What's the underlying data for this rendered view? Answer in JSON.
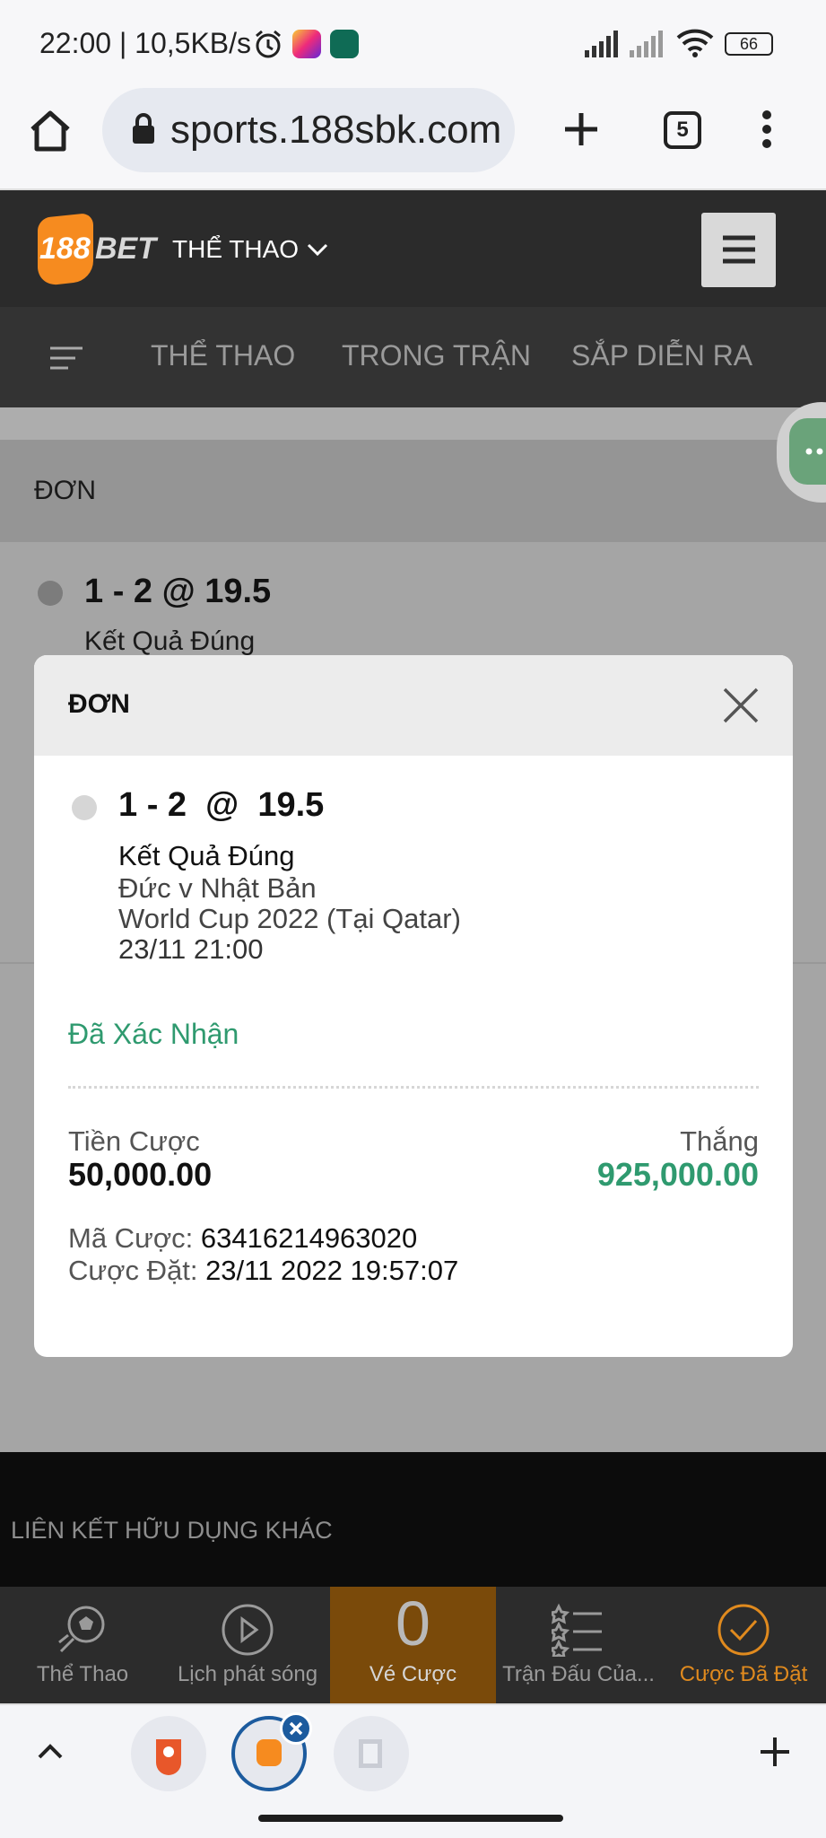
{
  "status_bar": {
    "time_speed": "22:00 | 10,5KB/s",
    "battery": "66"
  },
  "browser": {
    "url": "sports.188sbk.com",
    "tab_count": "5"
  },
  "site_header": {
    "logo_number": "188",
    "logo_word": "BET",
    "sport_dropdown": "THỂ THAO"
  },
  "nav": {
    "tabs": [
      "THỂ THAO",
      "TRONG TRẬN",
      "SẮP DIỄN RA"
    ]
  },
  "background": {
    "section_title": "ĐƠN",
    "odds": "1 - 2  @  19.5",
    "market": "Kết Quả Đúng"
  },
  "modal": {
    "title": "ĐƠN",
    "odds": "1 - 2  @  19.5",
    "market": "Kết Quả Đúng",
    "match": "Đức v Nhật Bản",
    "competition": "World Cup 2022 (Tại Qatar)",
    "kickoff": "23/11 21:00",
    "status": "Đã Xác Nhận",
    "stake_label": "Tiền Cược",
    "stake_value": "50,000.00",
    "win_label": "Thắng",
    "win_value": "925,000.00",
    "ref_label": "Mã Cược:",
    "ref_value": "63416214963020",
    "placed_label": "Cược Đặt:",
    "placed_value": "23/11 2022 19:57:07"
  },
  "footer": {
    "links_title": "LIÊN KẾT HỮU DỤNG KHÁC"
  },
  "bottom_nav": {
    "items": [
      "Thể Thao",
      "Lịch phát sóng",
      "Vé Cược",
      "Trận Đấu Của...",
      "Cược Đã Đặt"
    ],
    "bet_count": "0"
  },
  "colors": {
    "brand_orange": "#f68b1f",
    "accent_green": "#2f9a6f",
    "active_nav": "#e08a1e"
  }
}
